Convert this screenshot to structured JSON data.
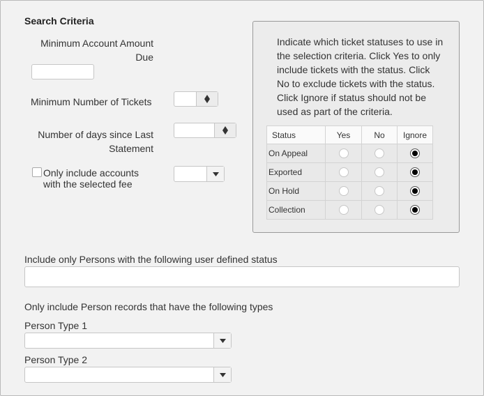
{
  "search_criteria": {
    "title": "Search Criteria",
    "min_amount_label": "Minimum Account Amount Due",
    "min_amount_value": "",
    "min_tickets_label": "Minimum Number of Tickets",
    "min_tickets_value": "",
    "days_since_label": "Number of days since Last Statement",
    "days_since_value": "",
    "selected_fee_label": "Only include accounts with the selected fee",
    "selected_fee_checked": false,
    "selected_fee_value": ""
  },
  "status_panel": {
    "instructions": "Indicate which ticket statuses to use in the selection criteria. Click Yes to only include tickets with the status. Click No to exclude tickets with the status. Click Ignore if status should not be used as part of the criteria.",
    "columns": [
      "Status",
      "Yes",
      "No",
      "Ignore"
    ],
    "rows": [
      {
        "name": "On Appeal",
        "selected": "Ignore"
      },
      {
        "name": "Exported",
        "selected": "Ignore"
      },
      {
        "name": "On Hold",
        "selected": "Ignore"
      },
      {
        "name": "Collection",
        "selected": "Ignore"
      }
    ]
  },
  "user_defined": {
    "label": "Include only Persons with the following user defined status",
    "value": ""
  },
  "person_types": {
    "label": "Only include Person records that have the following types",
    "type1_label": "Person Type 1",
    "type1_value": "",
    "type2_label": "Person Type 2",
    "type2_value": ""
  },
  "icons": {
    "spinner": "up-down-spinner-icon",
    "dropdown": "chevron-down-icon"
  }
}
